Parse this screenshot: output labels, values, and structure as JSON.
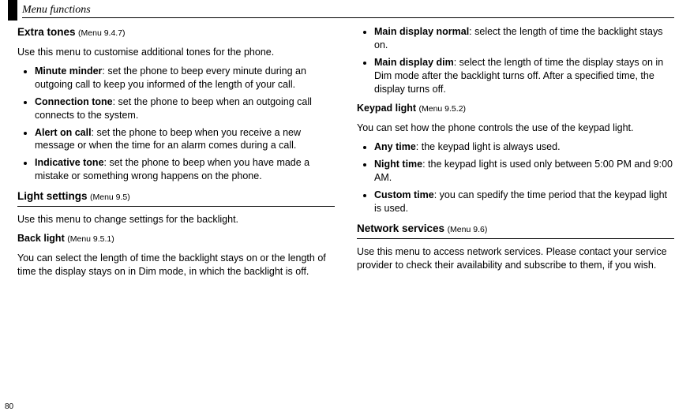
{
  "header": {
    "section": "Menu functions",
    "page_number": "80"
  },
  "left": {
    "extra_tones": {
      "title": "Extra tones",
      "ref": "(Menu 9.4.7)",
      "intro": "Use this menu to customise additional tones for the phone.",
      "items": [
        {
          "term": "Minute minder",
          "desc": ": set the phone to beep every minute during an outgoing call to keep you informed of the length of your call."
        },
        {
          "term": "Connection tone",
          "desc": ": set the phone to beep when an outgoing call connects to the system."
        },
        {
          "term": "Alert on call",
          "desc": ": set the phone to beep when you receive a new message or when the time for an alarm comes during a call."
        },
        {
          "term": "Indicative tone",
          "desc": ": set the phone to beep when you have made a mistake or something wrong happens on the phone."
        }
      ]
    },
    "light_settings": {
      "title": "Light settings",
      "ref": "(Menu 9.5)",
      "intro": "Use this menu to change settings for the backlight."
    },
    "back_light": {
      "title": "Back light",
      "ref": "(Menu 9.5.1)",
      "intro": "You can select the length of time the backlight stays on or the length of time the display stays on in Dim mode, in which the backlight is off."
    }
  },
  "right": {
    "display_items": [
      {
        "term": "Main display normal",
        "desc": ": select the length of time the backlight stays on."
      },
      {
        "term": "Main display dim",
        "desc": ": select the length of time the display stays on in Dim mode after the backlight turns off. After a specified time, the display turns off."
      }
    ],
    "keypad_light": {
      "title": "Keypad light",
      "ref": "(Menu 9.5.2)",
      "intro": "You can set how the phone controls the use of the keypad light.",
      "items": [
        {
          "term": "Any time",
          "desc": ": the keypad light is always used."
        },
        {
          "term": "Night time",
          "desc": ": the keypad light is used only between 5:00 PM and 9:00 AM."
        },
        {
          "term": "Custom time",
          "desc": ": you can spedify the time period that the keypad light is used."
        }
      ]
    },
    "network_services": {
      "title": "Network services",
      "ref": "(Menu 9.6)",
      "intro": "Use this menu to access network services. Please contact your service provider to check their availability and subscribe to them, if you wish."
    }
  }
}
